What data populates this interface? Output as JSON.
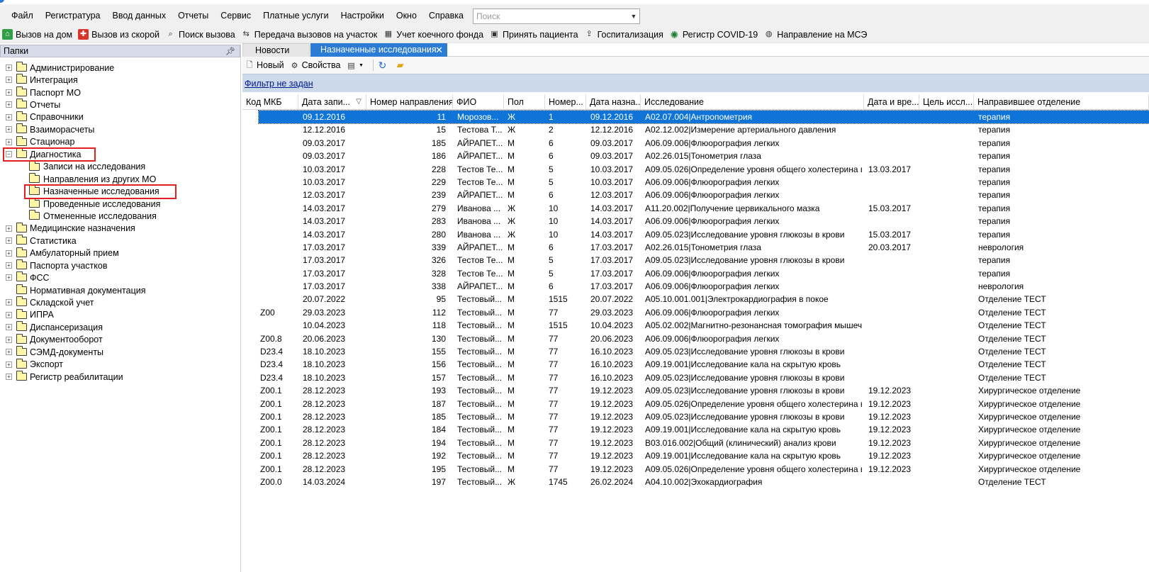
{
  "menu": [
    "Файл",
    "Регистратура",
    "Ввод данных",
    "Отчеты",
    "Сервис",
    "Платные услуги",
    "Настройки",
    "Окно",
    "Справка"
  ],
  "search": {
    "placeholder": "Поиск"
  },
  "toolbar": [
    {
      "label": "Вызов на дом",
      "icon": "house-call-icon"
    },
    {
      "label": "Вызов из скорой",
      "icon": "ambulance-call-icon"
    },
    {
      "label": "Поиск вызова",
      "icon": "search-call-icon"
    },
    {
      "label": "Передача вызовов на участок",
      "icon": "transfer-icon"
    },
    {
      "label": "Учет коечного фонда",
      "icon": "bed-fund-icon"
    },
    {
      "label": "Принять пациента",
      "icon": "accept-patient-icon"
    },
    {
      "label": "Госпитализация",
      "icon": "hospitalization-icon"
    },
    {
      "label": "Регистр COVID-19",
      "icon": "virus-icon"
    },
    {
      "label": "Направление на МСЭ",
      "icon": "mse-referral-icon"
    }
  ],
  "folders": {
    "title": "Папки",
    "items": [
      {
        "label": "Администрирование",
        "level": 0
      },
      {
        "label": "Интеграция",
        "level": 0
      },
      {
        "label": "Паспорт МО",
        "level": 0
      },
      {
        "label": "Отчеты",
        "level": 0
      },
      {
        "label": "Справочники",
        "level": 0
      },
      {
        "label": "Взаиморасчеты",
        "level": 0
      },
      {
        "label": "Стационар",
        "level": 0
      },
      {
        "label": "Диагностика",
        "level": 0,
        "expanded": true
      },
      {
        "label": "Записи на исследования",
        "level": 1
      },
      {
        "label": "Направления из других МО",
        "level": 1
      },
      {
        "label": "Назначенные исследования",
        "level": 1,
        "open": true
      },
      {
        "label": "Проведенные исследования",
        "level": 1
      },
      {
        "label": "Отмененные исследования",
        "level": 1
      },
      {
        "label": "Медицинские назначения",
        "level": 0
      },
      {
        "label": "Статистика",
        "level": 0
      },
      {
        "label": "Амбулаторный прием",
        "level": 0
      },
      {
        "label": "Паспорта участков",
        "level": 0
      },
      {
        "label": "ФСС",
        "level": 0
      },
      {
        "label": "Нормативная документация",
        "level": 0,
        "noexp": true
      },
      {
        "label": "Складской учет",
        "level": 0
      },
      {
        "label": "ИПРА",
        "level": 0
      },
      {
        "label": "Диспансеризация",
        "level": 0
      },
      {
        "label": "Документооборот",
        "level": 0
      },
      {
        "label": "СЭМД-документы",
        "level": 0
      },
      {
        "label": "Экспорт",
        "level": 0
      },
      {
        "label": "Регистр реабилитации",
        "level": 0
      }
    ]
  },
  "tabs": {
    "news": "Новости",
    "active": "Назначенные исследования"
  },
  "subtoolbar": {
    "new": "Новый",
    "props": "Свойства"
  },
  "filter": {
    "text": "Фильтр не задан"
  },
  "table": {
    "columns": [
      "Код МКБ",
      "Дата запи...",
      "Номер направления",
      "ФИО",
      "Пол",
      "Номер...",
      "Дата назна...",
      "Исследование",
      "Дата и вре...",
      "Цель иссл...",
      "Направившее отделение"
    ],
    "rows": [
      [
        "",
        "09.12.2016",
        "11",
        "Морозов...",
        "Ж",
        "1",
        "09.12.2016",
        "A02.07.004|Антропометрия",
        "",
        "",
        "терапия"
      ],
      [
        "",
        "12.12.2016",
        "15",
        "Тестова Т...",
        "Ж",
        "2",
        "12.12.2016",
        "A02.12.002|Измерение артериального давления",
        "",
        "",
        "терапия"
      ],
      [
        "",
        "09.03.2017",
        "185",
        "АЙРАПЕТ...",
        "М",
        "6",
        "09.03.2017",
        "A06.09.006|Флюорография легких",
        "",
        "",
        "терапия"
      ],
      [
        "",
        "09.03.2017",
        "186",
        "АЙРАПЕТ...",
        "М",
        "6",
        "09.03.2017",
        "A02.26.015|Тонометрия глаза",
        "",
        "",
        "терапия"
      ],
      [
        "",
        "10.03.2017",
        "228",
        "Тестов Те...",
        "М",
        "5",
        "10.03.2017",
        "A09.05.026|Определение уровня общего холестерина в...",
        "13.03.2017",
        "",
        "терапия"
      ],
      [
        "",
        "10.03.2017",
        "229",
        "Тестов Те...",
        "М",
        "5",
        "10.03.2017",
        "A06.09.006|Флюорография легких",
        "",
        "",
        "терапия"
      ],
      [
        "",
        "12.03.2017",
        "239",
        "АЙРАПЕТ...",
        "М",
        "6",
        "12.03.2017",
        "A06.09.006|Флюорография легких",
        "",
        "",
        "терапия"
      ],
      [
        "",
        "14.03.2017",
        "279",
        "Иванова ...",
        "Ж",
        "10",
        "14.03.2017",
        "A11.20.002|Получение цервикального мазка",
        "15.03.2017",
        "",
        "терапия"
      ],
      [
        "",
        "14.03.2017",
        "283",
        "Иванова ...",
        "Ж",
        "10",
        "14.03.2017",
        "A06.09.006|Флюорография легких",
        "",
        "",
        "терапия"
      ],
      [
        "",
        "14.03.2017",
        "280",
        "Иванова ...",
        "Ж",
        "10",
        "14.03.2017",
        "A09.05.023|Исследование уровня глюкозы в крови",
        "15.03.2017",
        "",
        "терапия"
      ],
      [
        "",
        "17.03.2017",
        "339",
        "АЙРАПЕТ...",
        "М",
        "6",
        "17.03.2017",
        "A02.26.015|Тонометрия глаза",
        "20.03.2017",
        "",
        "неврология"
      ],
      [
        "",
        "17.03.2017",
        "326",
        "Тестов Те...",
        "М",
        "5",
        "17.03.2017",
        "A09.05.023|Исследование уровня глюкозы в крови",
        "",
        "",
        "терапия"
      ],
      [
        "",
        "17.03.2017",
        "328",
        "Тестов Те...",
        "М",
        "5",
        "17.03.2017",
        "A06.09.006|Флюорография легких",
        "",
        "",
        "терапия"
      ],
      [
        "",
        "17.03.2017",
        "338",
        "АЙРАПЕТ...",
        "М",
        "6",
        "17.03.2017",
        "A06.09.006|Флюорография легких",
        "",
        "",
        "неврология"
      ],
      [
        "",
        "20.07.2022",
        "95",
        "Тестовый...",
        "М",
        "1515",
        "20.07.2022",
        "A05.10.001.001|Электрокардиография в покое",
        "",
        "",
        "Отделение ТЕСТ"
      ],
      [
        "Z00",
        "29.03.2023",
        "112",
        "Тестовый...",
        "М",
        "77",
        "29.03.2023",
        "A06.09.006|Флюорография легких",
        "",
        "",
        "Отделение ТЕСТ"
      ],
      [
        "",
        "10.04.2023",
        "118",
        "Тестовый...",
        "М",
        "1515",
        "10.04.2023",
        "A05.02.002|Магнитно-резонансная томография мышеч...",
        "",
        "",
        "Отделение ТЕСТ"
      ],
      [
        "Z00.8",
        "20.06.2023",
        "130",
        "Тестовый...",
        "М",
        "77",
        "20.06.2023",
        "A06.09.006|Флюорография легких",
        "",
        "",
        "Отделение ТЕСТ"
      ],
      [
        "D23.4",
        "18.10.2023",
        "155",
        "Тестовый...",
        "М",
        "77",
        "16.10.2023",
        "A09.05.023|Исследование уровня глюкозы в крови",
        "",
        "",
        "Отделение ТЕСТ"
      ],
      [
        "D23.4",
        "18.10.2023",
        "156",
        "Тестовый...",
        "М",
        "77",
        "16.10.2023",
        "A09.19.001|Исследование кала на скрытую кровь",
        "",
        "",
        "Отделение ТЕСТ"
      ],
      [
        "D23.4",
        "18.10.2023",
        "157",
        "Тестовый...",
        "М",
        "77",
        "16.10.2023",
        "A09.05.023|Исследование уровня глюкозы в крови",
        "",
        "",
        "Отделение ТЕСТ"
      ],
      [
        "Z00.1",
        "28.12.2023",
        "193",
        "Тестовый...",
        "М",
        "77",
        "19.12.2023",
        "A09.05.023|Исследование уровня глюкозы в крови",
        "19.12.2023",
        "",
        "Хирургическое отделение"
      ],
      [
        "Z00.1",
        "28.12.2023",
        "187",
        "Тестовый...",
        "М",
        "77",
        "19.12.2023",
        "A09.05.026|Определение уровня общего холестерина в...",
        "19.12.2023",
        "",
        "Хирургическое отделение"
      ],
      [
        "Z00.1",
        "28.12.2023",
        "185",
        "Тестовый...",
        "М",
        "77",
        "19.12.2023",
        "A09.05.023|Исследование уровня глюкозы в крови",
        "19.12.2023",
        "",
        "Хирургическое отделение"
      ],
      [
        "Z00.1",
        "28.12.2023",
        "184",
        "Тестовый...",
        "М",
        "77",
        "19.12.2023",
        "A09.19.001|Исследование кала на скрытую кровь",
        "19.12.2023",
        "",
        "Хирургическое отделение"
      ],
      [
        "Z00.1",
        "28.12.2023",
        "194",
        "Тестовый...",
        "М",
        "77",
        "19.12.2023",
        "B03.016.002|Общий (клинический) анализ крови",
        "19.12.2023",
        "",
        "Хирургическое отделение"
      ],
      [
        "Z00.1",
        "28.12.2023",
        "192",
        "Тестовый...",
        "М",
        "77",
        "19.12.2023",
        "A09.19.001|Исследование кала на скрытую кровь",
        "19.12.2023",
        "",
        "Хирургическое отделение"
      ],
      [
        "Z00.1",
        "28.12.2023",
        "195",
        "Тестовый...",
        "М",
        "77",
        "19.12.2023",
        "A09.05.026|Определение уровня общего холестерина в...",
        "19.12.2023",
        "",
        "Хирургическое отделение"
      ],
      [
        "Z00.0",
        "14.03.2024",
        "197",
        "Тестовый...",
        "Ж",
        "1745",
        "26.02.2024",
        "A04.10.002|Эхокардиография",
        "",
        "",
        "Отделение ТЕСТ"
      ]
    ]
  },
  "colors": {
    "accent": "#2a7cd4",
    "selected_row": "#0e74d8",
    "highlight": "#e32020",
    "filter_bg": "#ccd9ea"
  }
}
